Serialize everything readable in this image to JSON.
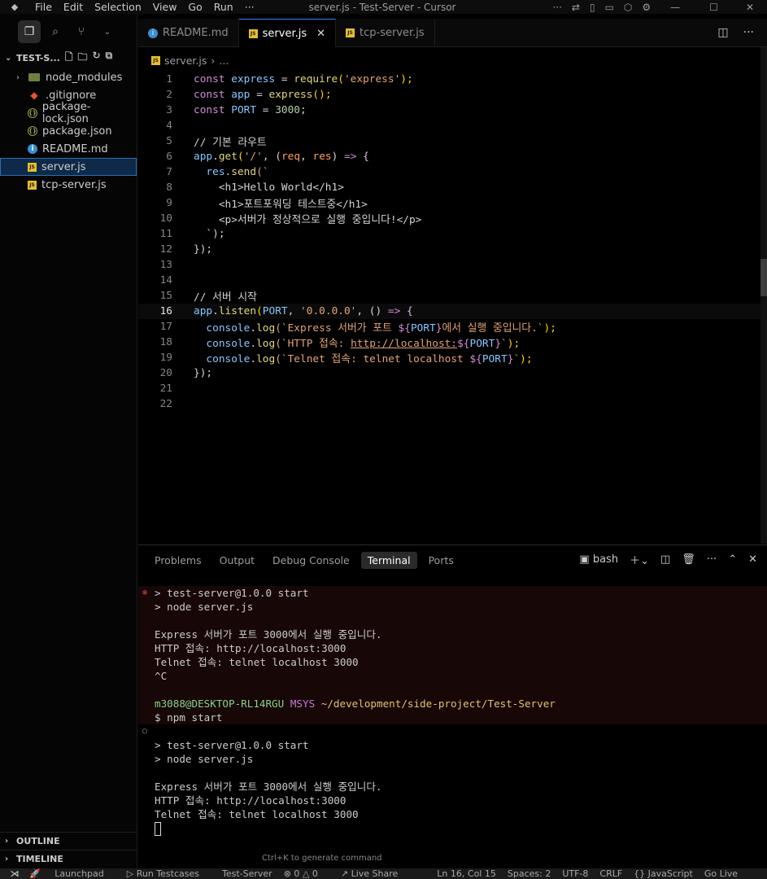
{
  "titlebar": {
    "menu": [
      "File",
      "Edit",
      "Selection",
      "View",
      "Go",
      "Run",
      "···"
    ],
    "title": "server.js - Test-Server - Cursor"
  },
  "sidebar": {
    "section_title": "TEST-S...",
    "items": [
      {
        "label": "node_modules",
        "icon": "folder-icon",
        "type": "folder"
      },
      {
        "label": ".gitignore",
        "icon": "git-icon",
        "type": "git"
      },
      {
        "label": "package-lock.json",
        "icon": "json-icon",
        "type": "json"
      },
      {
        "label": "package.json",
        "icon": "json-icon",
        "type": "json"
      },
      {
        "label": "README.md",
        "icon": "info-icon",
        "type": "info"
      },
      {
        "label": "server.js",
        "icon": "js-icon",
        "type": "js",
        "selected": true
      },
      {
        "label": "tcp-server.js",
        "icon": "js-icon",
        "type": "js"
      }
    ],
    "outline": "OUTLINE",
    "timeline": "TIMELINE"
  },
  "tabs": [
    {
      "label": "README.md",
      "icon": "info-icon",
      "active": false
    },
    {
      "label": "server.js",
      "icon": "js-icon",
      "active": true
    },
    {
      "label": "tcp-server.js",
      "icon": "js-icon",
      "active": false
    }
  ],
  "breadcrumb": {
    "file": "server.js",
    "rest": "..."
  },
  "editor": {
    "current_line": 16,
    "lines": [
      "1",
      "2",
      "3",
      "4",
      "5",
      "6",
      "7",
      "8",
      "9",
      "10",
      "11",
      "12",
      "13",
      "14",
      "15",
      "16",
      "17",
      "18",
      "19",
      "20",
      "21",
      "22"
    ]
  },
  "panel": {
    "tabs": [
      "Problems",
      "Output",
      "Debug Console",
      "Terminal",
      "Ports"
    ],
    "active_tab": "Terminal",
    "shell": "bash",
    "terminal": {
      "run1": [
        "> test-server@1.0.0 start",
        "> node server.js",
        "",
        "Express 서버가 포트 3000에서 실행 중입니다.",
        "HTTP 접속: http://localhost:3000",
        "Telnet 접속: telnet localhost 3000",
        "^C"
      ],
      "prompt_user": "m3088@DESKTOP-RL14RGU",
      "prompt_env": "MSYS",
      "prompt_path": "~/development/side-project/Test-Server",
      "command": "$ npm start",
      "run2": [
        "> test-server@1.0.0 start",
        "> node server.js",
        "",
        "Express 서버가 포트 3000에서 실행 중입니다.",
        "HTTP 접속: http://localhost:3000",
        "Telnet 접속: telnet localhost 3000"
      ]
    },
    "hint": "Ctrl+K to generate command"
  },
  "statusbar": {
    "items": [
      "Launchpad",
      "Run Testcases",
      "Test-Server",
      "0 △ 0",
      "Live Share",
      "Ln 16, Col 15",
      "Spaces: 2",
      "UTF-8",
      "CRLF",
      "{} JavaScript",
      "Go Live"
    ]
  },
  "code": {
    "l1": [
      "const",
      " express ",
      "=",
      " require",
      "(",
      "'express'",
      ");"
    ],
    "l2": [
      "const",
      " app ",
      "=",
      " express",
      "();"
    ],
    "l3": [
      "const",
      " PORT ",
      "=",
      " 3000",
      ";"
    ],
    "l5": "// 기본 라우트",
    "l6": [
      "app",
      ".",
      "get",
      "(",
      "'/'",
      ", (",
      "req",
      ", ",
      "res",
      ") ",
      "=>",
      " {"
    ],
    "l7": [
      "  res",
      ".",
      "send",
      "(`"
    ],
    "l8": "    <h1>Hello World</h1>",
    "l9": "    <h1>포트포워딩 테스트중</h1>",
    "l10": "    <p>서버가 정상적으로 실행 중입니다!</p>",
    "l11": "  `);",
    "l12": "});",
    "l15": "// 서버 시작",
    "l16": [
      "app",
      ".",
      "listen",
      "(",
      "PORT",
      ", ",
      "'0.0.0.0'",
      ", () ",
      "=>",
      " {"
    ],
    "l17": [
      "  console",
      ".",
      "log",
      "(`Express 서버가 포트 ",
      "${",
      "PORT",
      "}",
      "에서 실행 중입니다.`",
      ");"
    ],
    "l18": [
      "  console",
      ".",
      "log",
      "(`HTTP 접속: ",
      "http://localhost:",
      "${",
      "PORT",
      "}",
      "`",
      ");"
    ],
    "l19": [
      "  console",
      ".",
      "log",
      "(`Telnet 접속: telnet localhost ",
      "${",
      "PORT",
      "}",
      "`",
      ");"
    ],
    "l20": "});"
  }
}
